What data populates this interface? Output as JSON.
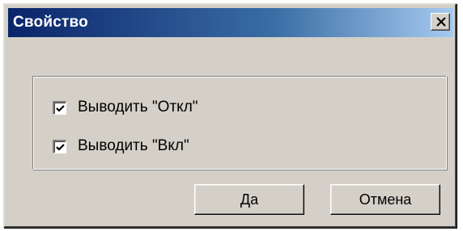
{
  "window": {
    "title": "Свойство",
    "close_icon": "close-icon"
  },
  "options": [
    {
      "label": "Выводить \"Откл\"",
      "checked": true
    },
    {
      "label": "Выводить \"Вкл\"",
      "checked": true
    }
  ],
  "buttons": {
    "ok_label": "Да",
    "cancel_label": "Отмена"
  },
  "colors": {
    "title_gradient_start": "#0a246a",
    "title_gradient_end": "#a6caf0",
    "face": "#d4d0c8"
  }
}
